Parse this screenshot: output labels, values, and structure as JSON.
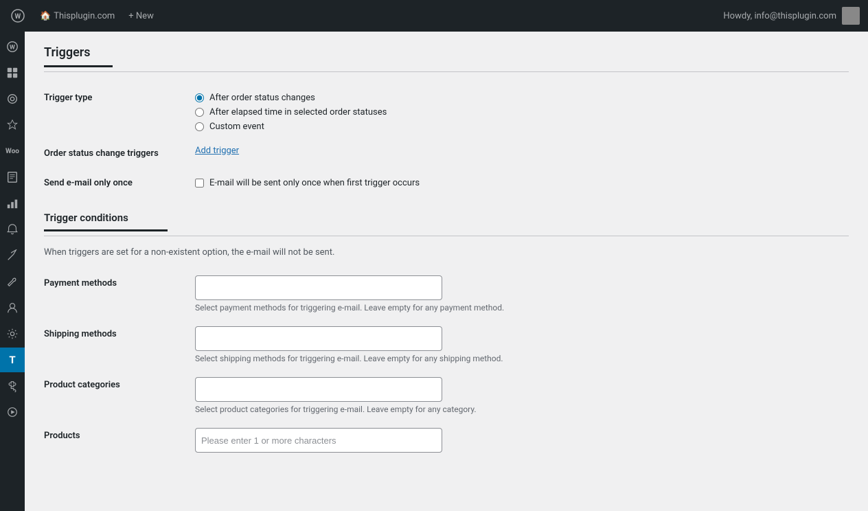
{
  "adminBar": {
    "wpLogoLabel": "WordPress",
    "siteIcon": "🏠",
    "siteName": "Thisplugin.com",
    "newLabel": "+ New",
    "howdy": "Howdy, info@thisplugin.com"
  },
  "sidebar": {
    "icons": [
      {
        "name": "wordpress-logo",
        "symbol": "⊞",
        "active": false
      },
      {
        "name": "dashboard",
        "symbol": "⊟",
        "active": false
      },
      {
        "name": "performance",
        "symbol": "◎",
        "active": false
      },
      {
        "name": "pin",
        "symbol": "📌",
        "active": false
      },
      {
        "name": "woo",
        "label": "Woo",
        "active": false
      },
      {
        "name": "pages",
        "symbol": "🗋",
        "active": false
      },
      {
        "name": "analytics",
        "symbol": "📊",
        "active": false
      },
      {
        "name": "bell",
        "symbol": "🔔",
        "active": false
      },
      {
        "name": "tools1",
        "symbol": "⚒",
        "active": false
      },
      {
        "name": "tools2",
        "symbol": "🔧",
        "active": false
      },
      {
        "name": "user",
        "symbol": "👤",
        "active": false
      },
      {
        "name": "wrench",
        "symbol": "🔩",
        "active": false
      },
      {
        "name": "plugin-active",
        "symbol": "T",
        "active": true
      },
      {
        "name": "puzzle",
        "symbol": "🧩",
        "active": false
      },
      {
        "name": "play",
        "symbol": "▶",
        "active": false
      }
    ]
  },
  "page": {
    "title": "Triggers",
    "triggerType": {
      "label": "Trigger type",
      "options": [
        {
          "id": "after-order-status",
          "label": "After order status changes",
          "checked": true
        },
        {
          "id": "after-elapsed",
          "label": "After elapsed time in selected order statuses",
          "checked": false
        },
        {
          "id": "custom-event",
          "label": "Custom event",
          "checked": false
        }
      ]
    },
    "orderStatusChange": {
      "label": "Order status change triggers",
      "addTriggerLabel": "Add trigger"
    },
    "sendEmailOnce": {
      "label": "Send e-mail only once",
      "checkboxLabel": "E-mail will be sent only once when first trigger occurs",
      "checked": false
    },
    "triggerConditions": {
      "sectionTitle": "Trigger conditions",
      "infoText": "When triggers are set for a non-existent option, the e-mail will not be sent.",
      "paymentMethods": {
        "label": "Payment methods",
        "placeholder": "",
        "hint": "Select payment methods for triggering e-mail. Leave empty for any payment method."
      },
      "shippingMethods": {
        "label": "Shipping methods",
        "placeholder": "",
        "hint": "Select shipping methods for triggering e-mail. Leave empty for any shipping method."
      },
      "productCategories": {
        "label": "Product categories",
        "placeholder": "",
        "hint": "Select product categories for triggering e-mail. Leave empty for any category."
      },
      "products": {
        "label": "Products",
        "placeholder": "Please enter 1 or more characters"
      }
    }
  }
}
